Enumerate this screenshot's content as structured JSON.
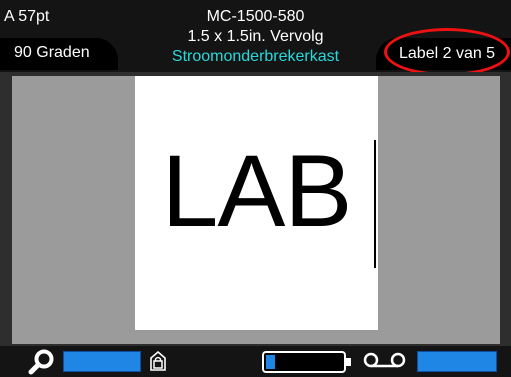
{
  "header": {
    "font_size": "A 57pt",
    "rotation": "90 Graden",
    "model": "MC-1500-580",
    "size_line": "1.5 x 1.5in. Vervolg",
    "category": "Stroomonderbrekerkast",
    "label_counter": "Label 2 van 5"
  },
  "label": {
    "text": "LAB"
  },
  "bottom": {
    "battery_level": 0.12
  },
  "colors": {
    "accent_cyan": "#28d9dc",
    "button_blue": "#1f86e6",
    "highlight_red": "#e11111"
  },
  "icons": [
    "zoom-icon",
    "lock-icon",
    "battery-icon",
    "cassette-icon"
  ]
}
